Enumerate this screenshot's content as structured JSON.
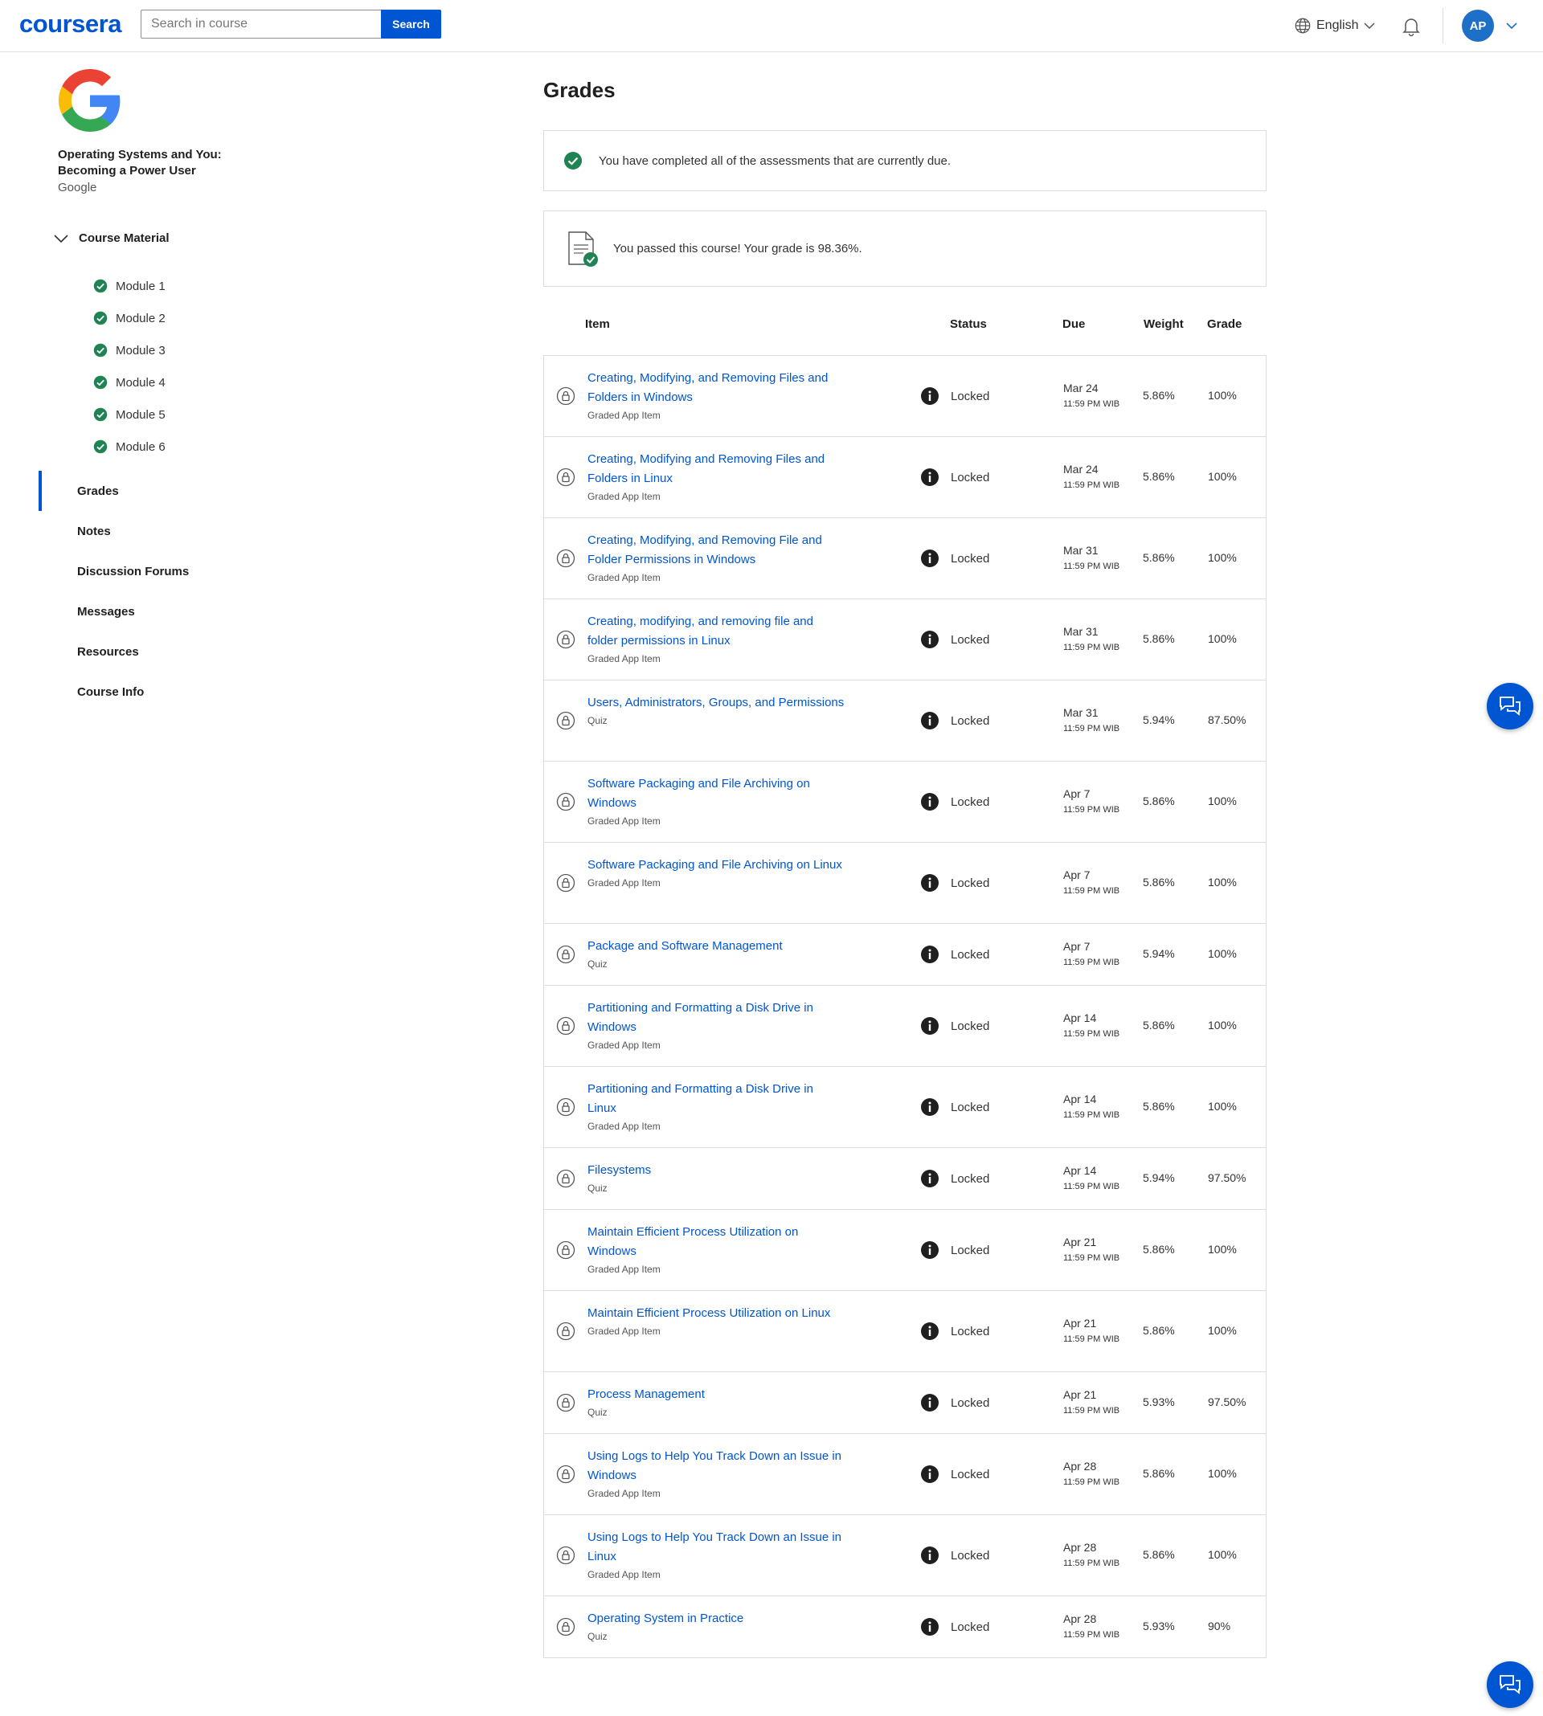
{
  "header": {
    "logo": "coursera",
    "search_placeholder": "Search in course",
    "search_button": "Search",
    "language": "English",
    "avatar_initials": "AP"
  },
  "sidebar": {
    "course_title": "Operating Systems and You: Becoming a Power User",
    "partner": "Google",
    "course_material_label": "Course Material",
    "modules": [
      "Module 1",
      "Module 2",
      "Module 3",
      "Module 4",
      "Module 5",
      "Module 6"
    ],
    "nav": [
      "Grades",
      "Notes",
      "Discussion Forums",
      "Messages",
      "Resources",
      "Course Info"
    ],
    "active_nav": "Grades"
  },
  "main": {
    "title": "Grades",
    "notice_due": "You have completed all of the assessments that are currently due.",
    "notice_passed": "You passed this course! Your grade is 98.36%.",
    "columns": [
      "Item",
      "Status",
      "Due",
      "Weight",
      "Grade"
    ],
    "rows": [
      {
        "title": "Creating, Modifying, and Removing Files and Folders in Windows",
        "type": "Graded App Item",
        "status": "Locked",
        "due_date": "Mar 24",
        "due_time": "11:59 PM WIB",
        "weight": "5.86%",
        "grade": "100%"
      },
      {
        "title": "Creating, Modifying and Removing Files and Folders in Linux",
        "type": "Graded App Item",
        "status": "Locked",
        "due_date": "Mar 24",
        "due_time": "11:59 PM WIB",
        "weight": "5.86%",
        "grade": "100%"
      },
      {
        "title": "Creating, Modifying, and Removing File and Folder Permissions in Windows",
        "type": "Graded App Item",
        "status": "Locked",
        "due_date": "Mar 31",
        "due_time": "11:59 PM WIB",
        "weight": "5.86%",
        "grade": "100%"
      },
      {
        "title": "Creating, modifying, and removing file and folder permissions in Linux",
        "type": "Graded App Item",
        "status": "Locked",
        "due_date": "Mar 31",
        "due_time": "11:59 PM WIB",
        "weight": "5.86%",
        "grade": "100%"
      },
      {
        "title": "Users, Administrators, Groups, and Permissions",
        "type": "Quiz",
        "status": "Locked",
        "due_date": "Mar 31",
        "due_time": "11:59 PM WIB",
        "weight": "5.94%",
        "grade": "87.50%"
      },
      {
        "title": "Software Packaging and File Archiving on Windows",
        "type": "Graded App Item",
        "status": "Locked",
        "due_date": "Apr 7",
        "due_time": "11:59 PM WIB",
        "weight": "5.86%",
        "grade": "100%"
      },
      {
        "title": "Software Packaging and File Archiving on Linux",
        "type": "Graded App Item",
        "status": "Locked",
        "due_date": "Apr 7",
        "due_time": "11:59 PM WIB",
        "weight": "5.86%",
        "grade": "100%"
      },
      {
        "title": "Package and Software Management",
        "type": "Quiz",
        "status": "Locked",
        "due_date": "Apr 7",
        "due_time": "11:59 PM WIB",
        "weight": "5.94%",
        "grade": "100%"
      },
      {
        "title": "Partitioning and Formatting a Disk Drive in Windows",
        "type": "Graded App Item",
        "status": "Locked",
        "due_date": "Apr 14",
        "due_time": "11:59 PM WIB",
        "weight": "5.86%",
        "grade": "100%"
      },
      {
        "title": "Partitioning and Formatting a Disk Drive in Linux",
        "type": "Graded App Item",
        "status": "Locked",
        "due_date": "Apr 14",
        "due_time": "11:59 PM WIB",
        "weight": "5.86%",
        "grade": "100%"
      },
      {
        "title": "Filesystems",
        "type": "Quiz",
        "status": "Locked",
        "due_date": "Apr 14",
        "due_time": "11:59 PM WIB",
        "weight": "5.94%",
        "grade": "97.50%"
      },
      {
        "title": "Maintain Efficient Process Utilization on Windows",
        "type": "Graded App Item",
        "status": "Locked",
        "due_date": "Apr 21",
        "due_time": "11:59 PM WIB",
        "weight": "5.86%",
        "grade": "100%"
      },
      {
        "title": "Maintain Efficient Process Utilization on Linux",
        "type": "Graded App Item",
        "status": "Locked",
        "due_date": "Apr 21",
        "due_time": "11:59 PM WIB",
        "weight": "5.86%",
        "grade": "100%"
      },
      {
        "title": "Process Management",
        "type": "Quiz",
        "status": "Locked",
        "due_date": "Apr 21",
        "due_time": "11:59 PM WIB",
        "weight": "5.93%",
        "grade": "97.50%"
      },
      {
        "title": "Using Logs to Help You Track Down an Issue in Windows",
        "type": "Graded App Item",
        "status": "Locked",
        "due_date": "Apr 28",
        "due_time": "11:59 PM WIB",
        "weight": "5.86%",
        "grade": "100%"
      },
      {
        "title": "Using Logs to Help You Track Down an Issue in Linux",
        "type": "Graded App Item",
        "status": "Locked",
        "due_date": "Apr 28",
        "due_time": "11:59 PM WIB",
        "weight": "5.86%",
        "grade": "100%"
      },
      {
        "title": "Operating System in Practice",
        "type": "Quiz",
        "status": "Locked",
        "due_date": "Apr 28",
        "due_time": "11:59 PM WIB",
        "weight": "5.93%",
        "grade": "90%"
      }
    ]
  },
  "colors": {
    "brand_blue": "#0056d2",
    "success_green": "#1f8354",
    "border": "#dcdcdc"
  },
  "icons": {
    "lock": "lock-icon",
    "info": "info-icon",
    "check": "check-circle-icon",
    "globe": "globe-icon",
    "bell": "bell-icon",
    "chat": "chat-icon",
    "document": "document-check-icon"
  }
}
